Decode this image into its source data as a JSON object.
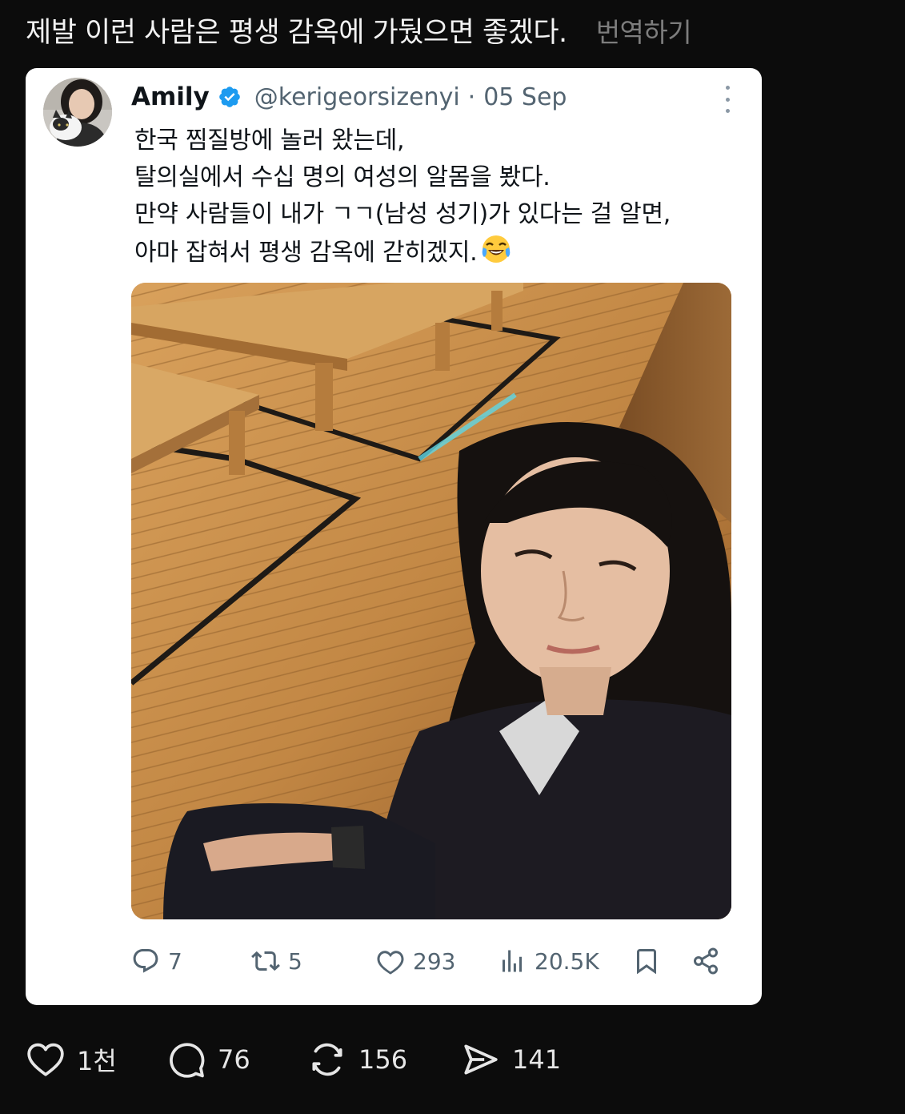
{
  "caption": {
    "text": "제발 이런 사람은 평생 감옥에 가뒀으면 좋겠다.",
    "translate_label": "번역하기"
  },
  "tweet": {
    "author_name": "Amily",
    "verified": true,
    "handle": "@kerigeorsizenyi",
    "separator": "·",
    "date": "05 Sep",
    "text_lines": [
      "한국 찜질방에 놀러 왔는데,",
      "탈의실에서 수십 명의 여성의 알몸을 봤다.",
      "만약 사람들이 내가 ㄱㄱ(남성 성기)가 있다는 걸 알면,",
      "아마 잡혀서 평생 감옥에 갇히겠지."
    ],
    "text_emoji": "face-with-tears-of-joy",
    "media_description_icon": "photo",
    "actions": {
      "replies": "7",
      "reposts": "5",
      "likes": "293",
      "views": "20.5K"
    }
  },
  "bottom_bar": {
    "likes": "1천",
    "comments": "76",
    "reposts": "156",
    "shares": "141"
  },
  "colors": {
    "background": "#0c0c0c",
    "card": "#ffffff",
    "verified_blue": "#1d9bf0",
    "muted": "#536471"
  }
}
